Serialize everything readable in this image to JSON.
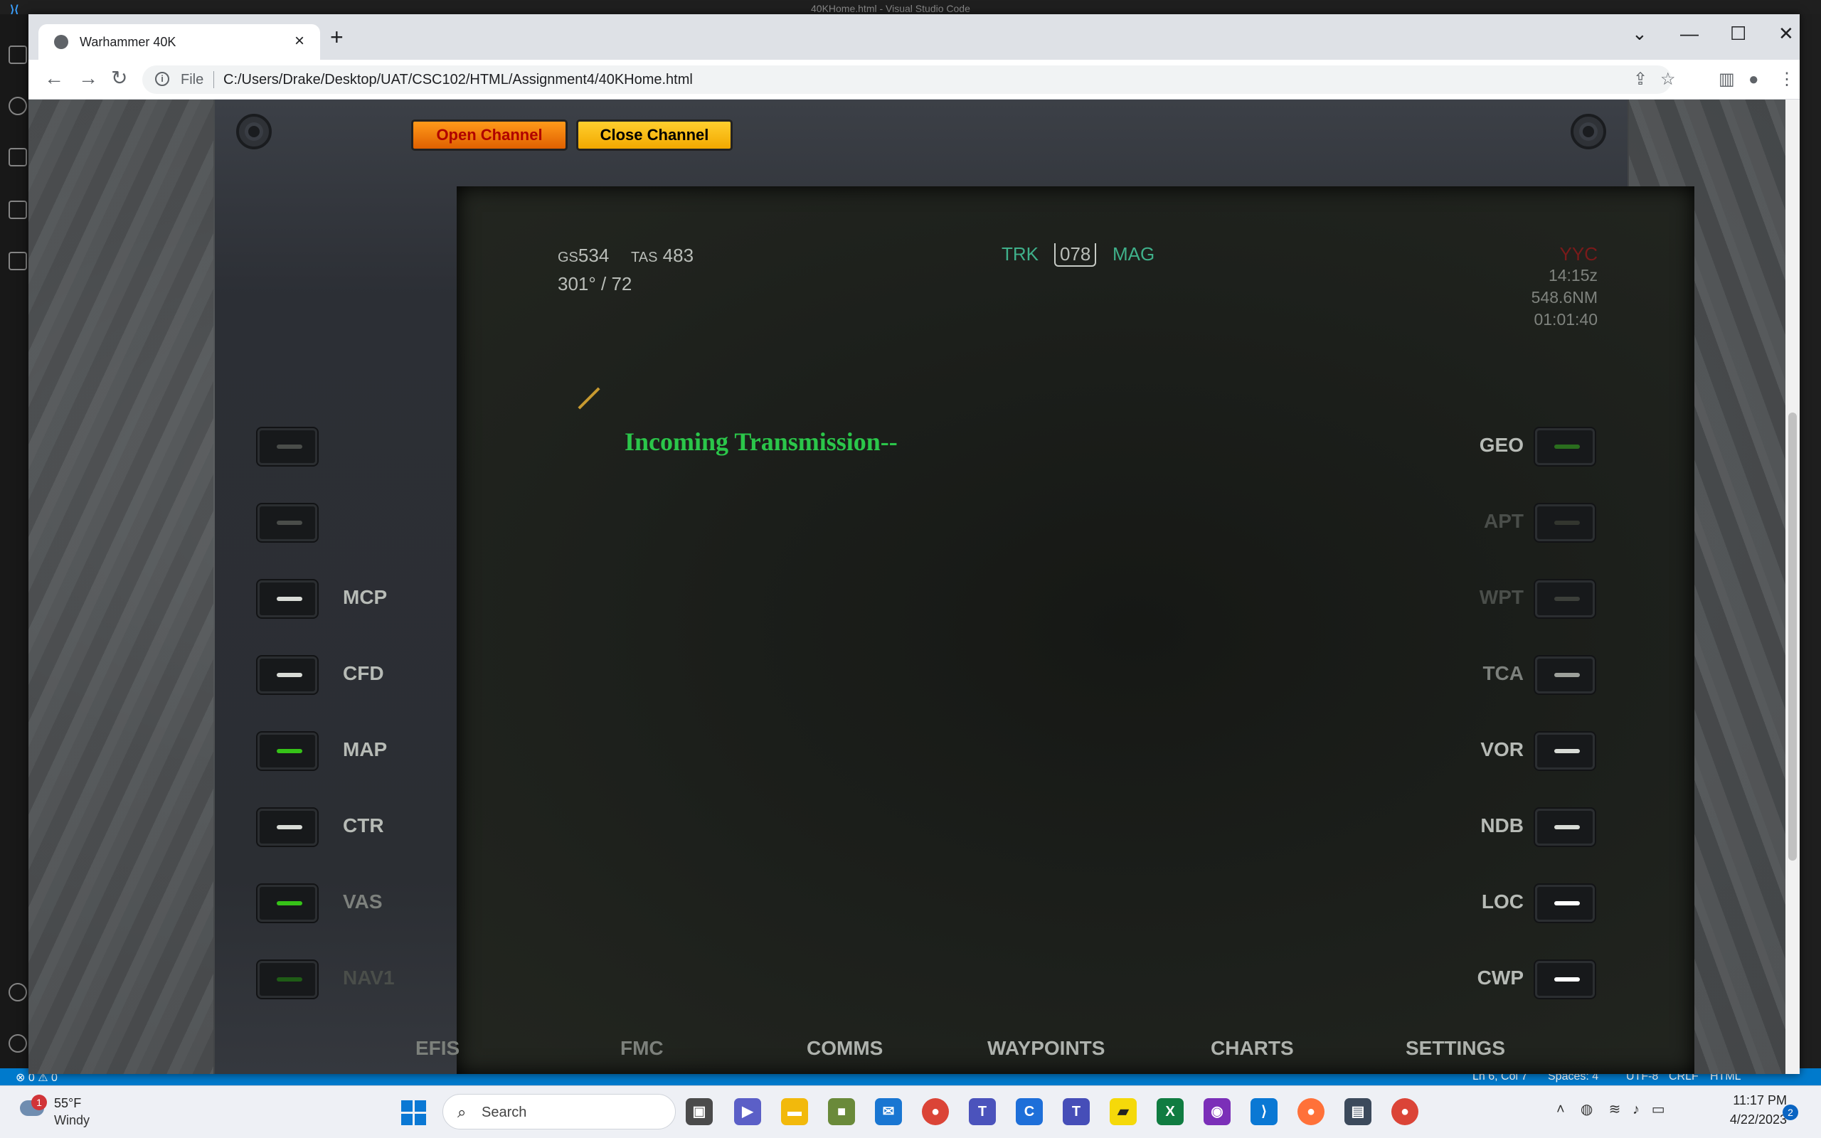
{
  "vscode": {
    "title": "40KHome.html - Visual Studio Code",
    "status": {
      "problems": "⊗ 0 ⚠ 0",
      "position": "Ln 6, Col 7",
      "spaces": "Spaces: 4",
      "encoding": "UTF-8",
      "eol": "CRLF",
      "language": "HTML"
    }
  },
  "browser": {
    "tab_title": "Warhammer 40K",
    "scheme_label": "File",
    "url": "C:/Users/Drake/Desktop/UAT/CSC102/HTML/Assignment4/40KHome.html"
  },
  "page": {
    "buttons": {
      "open": "Open Channel",
      "close": "Close Channel"
    },
    "hud": {
      "gs_label": "GS",
      "gs_value": "534",
      "tas_label": "TAS",
      "tas_value": "483",
      "wind": "301° / 72",
      "trk_label": "TRK",
      "trk_value": "078",
      "mag_label": "MAG",
      "airport": "YYC",
      "time": "14:15z",
      "distance": "548.6NM",
      "ete": "01:01:40"
    },
    "message": "Incoming Transmission--",
    "left_keys": [
      {
        "label": "",
        "lamp": "#4a4d4a"
      },
      {
        "label": "",
        "lamp": "#4a4d4a"
      },
      {
        "label": "MCP",
        "lamp": "#d8dbd6"
      },
      {
        "label": "CFD",
        "lamp": "#d8dbd6"
      },
      {
        "label": "MAP",
        "lamp": "#36c318"
      },
      {
        "label": "CTR",
        "lamp": "#d8dbd6"
      },
      {
        "label": "VAS",
        "lamp": "#36c318"
      },
      {
        "label": "NAV1",
        "lamp": "#1f5c16"
      }
    ],
    "right_keys": [
      {
        "label": "GEO",
        "lamp": "#2a6e1e"
      },
      {
        "label": "APT",
        "lamp": "#33362f"
      },
      {
        "label": "WPT",
        "lamp": "#3c3f3a"
      },
      {
        "label": "TCA",
        "lamp": "#9da09b"
      },
      {
        "label": "VOR",
        "lamp": "#d8dbd6"
      },
      {
        "label": "NDB",
        "lamp": "#d8dbd6"
      },
      {
        "label": "LOC",
        "lamp": "#ffffff"
      },
      {
        "label": "CWP",
        "lamp": "#ffffff"
      }
    ],
    "bottom_tabs": [
      "EFIS",
      "FMC",
      "COMMS",
      "WAYPOINTS",
      "CHARTS",
      "SETTINGS"
    ]
  },
  "taskbar": {
    "weather_badge": "1",
    "temperature": "55°F",
    "condition": "Windy",
    "search_placeholder": "Search",
    "time": "11:17 PM",
    "date": "4/22/2023",
    "notifications": "2"
  }
}
